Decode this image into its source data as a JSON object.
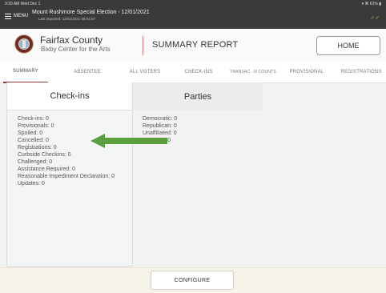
{
  "status_bar": {
    "time": "9:33 AM  Wed Dec 1",
    "indicators": "▾ ⌘ 61% ▮"
  },
  "header": {
    "menu_label": "MENU",
    "election_title": "Mount Rushmore Special Election - 12/01/2021",
    "last_updated": "Last imported: 12/01/2021 08:01:57",
    "user_icon": "users-icon",
    "user_glyph": "♂♂"
  },
  "brand": {
    "county": "Fairfax County",
    "location": "Bixby Center for the Arts",
    "page_title": "SUMMARY REPORT",
    "home_label": "HOME"
  },
  "tabs": [
    {
      "label": "SUMMARY",
      "active": true
    },
    {
      "label": "ABSENTEE",
      "active": false
    },
    {
      "label": "ALL VOTERS",
      "active": false
    },
    {
      "label": "CHECK-INS",
      "active": false
    },
    {
      "label": "TRANSAC...N COUNTS",
      "active": false
    },
    {
      "label": "PROVISIONAL",
      "active": false
    },
    {
      "label": "REGISTRATIONS",
      "active": false
    }
  ],
  "checkins": {
    "title": "Check-ins",
    "lines": [
      "Check-ins: 0",
      "Provisionals: 0",
      "Spoiled: 0",
      "Cancelled: 0",
      "Registrations: 0",
      "Curbside Checkins: 0",
      "Challenged: 0",
      "Assistance Required: 0",
      "Reasonable Impediment Declaration: 0",
      "Updates: 0"
    ]
  },
  "parties": {
    "title": "Parties",
    "lines": [
      "Democratic: 0",
      "Republican: 0",
      "Unaffiliated: 0",
      "No Party: 0"
    ]
  },
  "annotation": {
    "color": "#5b9e3c"
  },
  "footer": {
    "configure_label": "CONFIGURE"
  },
  "colors": {
    "accent": "#9b3a2a",
    "divider": "#e57373"
  }
}
